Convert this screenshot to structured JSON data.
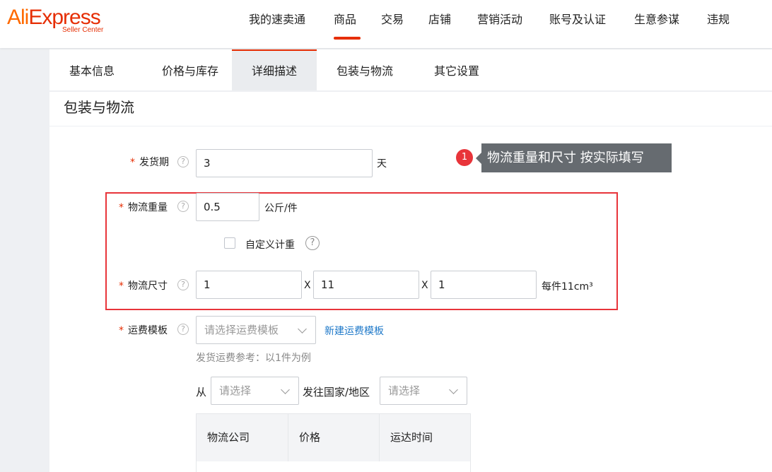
{
  "brand": {
    "logo_part1": "Ali",
    "logo_part2": "Express",
    "subtitle": "Seller Center",
    "logo_colors": [
      "#ff6a00",
      "#e62e04"
    ]
  },
  "top_nav": {
    "items": [
      "我的速卖通",
      "商品",
      "交易",
      "店铺",
      "营销活动",
      "账号及认证",
      "生意参谋",
      "违规"
    ],
    "active": "商品"
  },
  "tabs": {
    "items": [
      "基本信息",
      "价格与库存",
      "详细描述",
      "包装与物流",
      "其它设置"
    ],
    "active": "详细描述"
  },
  "section": {
    "title": "包装与物流"
  },
  "form": {
    "delivery_period": {
      "label": "发货期",
      "required_mark": "*",
      "value": "3",
      "unit": "天"
    },
    "weight": {
      "label": "物流重量",
      "required_mark": "*",
      "value": "0.5",
      "unit": "公斤/件"
    },
    "custom_weight": {
      "label": "自定义计重",
      "checked": false
    },
    "dimensions": {
      "label": "物流尺寸",
      "required_mark": "*",
      "length": "1",
      "width": "11",
      "height": "1",
      "separator": "X",
      "volume_label": "每件11cm³"
    },
    "shipping_template": {
      "label": "运费模板",
      "required_mark": "*",
      "placeholder": "请选择运费模板",
      "new_link": "新建运费模板"
    },
    "freight_reference": {
      "note": "发货运费参考：以1件为例",
      "from_label": "从",
      "from_placeholder": "请选择",
      "to_label": "发往国家/地区",
      "to_placeholder": "请选择"
    }
  },
  "annotation": {
    "badge": "1",
    "text": "物流重量和尺寸 按实际填写",
    "highlight_color": "#e8343a"
  },
  "freight_table": {
    "columns": [
      "物流公司",
      "价格",
      "运达时间"
    ]
  },
  "icons": {
    "help": "question-circle-icon",
    "dropdown": "chevron-down-icon"
  },
  "colors": {
    "accent": "#e62e04",
    "link": "#1f79c9"
  }
}
